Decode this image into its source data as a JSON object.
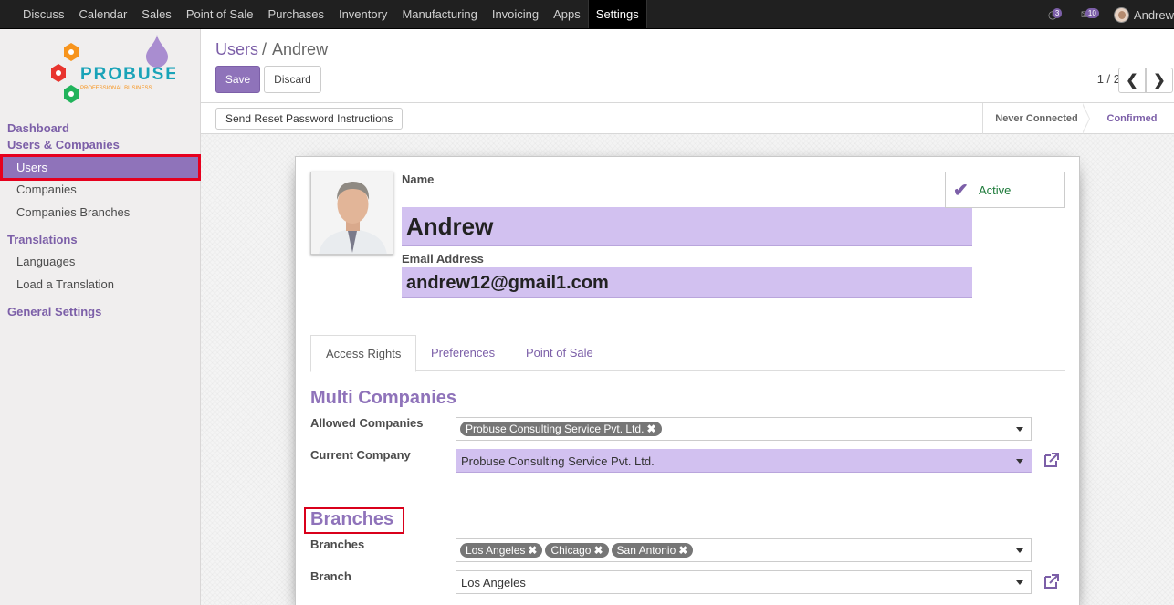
{
  "topbar": {
    "menu": [
      "Discuss",
      "Calendar",
      "Sales",
      "Point of Sale",
      "Purchases",
      "Inventory",
      "Manufacturing",
      "Invoicing",
      "Apps",
      "Settings"
    ],
    "active_menu": "Settings",
    "activity_count": "3",
    "messages_count": "10",
    "user_name": "Andrew"
  },
  "sidebar": {
    "logo_text": "PROBUSE",
    "logo_tagline": "PROFESSIONAL BUSINESS",
    "sections": {
      "dashboard": "Dashboard",
      "users_companies": "Users & Companies",
      "translations": "Translations",
      "general_settings": "General Settings"
    },
    "items": {
      "users": "Users",
      "companies": "Companies",
      "companies_branches": "Companies Branches",
      "languages": "Languages",
      "load_translation": "Load a Translation"
    }
  },
  "control_panel": {
    "breadcrumb_parent": "Users",
    "breadcrumb_sep": "/",
    "breadcrumb_current": "Andrew",
    "save_label": "Save",
    "discard_label": "Discard",
    "pager": "1 / 2"
  },
  "statusbar": {
    "reset_button": "Send Reset Password Instructions",
    "stage_never": "Never Connected",
    "stage_confirmed": "Confirmed"
  },
  "form": {
    "name_label": "Name",
    "name_value": "Andrew",
    "email_label": "Email Address",
    "email_value": "andrew12@gmail1.com",
    "active_label": "Active",
    "tabs": [
      "Access Rights",
      "Preferences",
      "Point of Sale"
    ],
    "multi_companies_title": "Multi Companies",
    "allowed_companies_label": "Allowed Companies",
    "allowed_companies_tags": [
      "Probuse Consulting Service Pvt. Ltd."
    ],
    "current_company_label": "Current Company",
    "current_company_value": "Probuse Consulting Service Pvt. Ltd.",
    "branches_title": "Branches",
    "branches_label": "Branches",
    "branches_tags": [
      "Los Angeles",
      "Chicago",
      "San Antonio"
    ],
    "branch_label": "Branch",
    "branch_value": "Los Angeles"
  },
  "colors": {
    "accent": "#8f73ba",
    "accent_dark": "#7c5fa8",
    "required_field_bg": "#d2c1f0",
    "highlight_red": "#e6001e"
  }
}
